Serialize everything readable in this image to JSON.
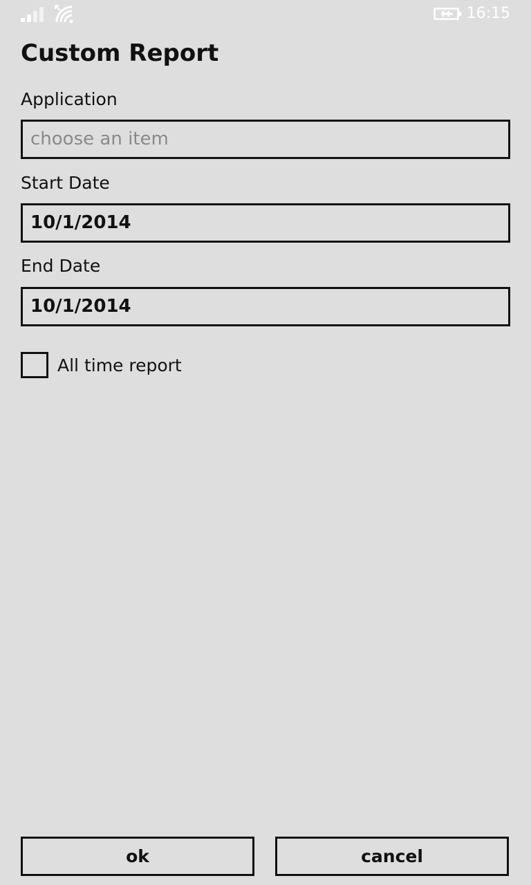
{
  "status_bar": {
    "time": "16:15",
    "icons": [
      "signal-icon",
      "wifi-icon",
      "battery-charging-icon"
    ]
  },
  "page": {
    "title": "Custom Report"
  },
  "form": {
    "application": {
      "label": "Application",
      "placeholder": "choose an item",
      "value": ""
    },
    "start_date": {
      "label": "Start Date",
      "value": "10/1/2014"
    },
    "end_date": {
      "label": "End Date",
      "value": "10/1/2014"
    },
    "all_time": {
      "label": "All time report",
      "checked": false
    }
  },
  "buttons": {
    "ok_label": "ok",
    "cancel_label": "cancel"
  },
  "colors": {
    "background": "#dedede",
    "foreground": "#111111",
    "placeholder": "#8a8a8a",
    "status_icons": "#ffffff"
  }
}
